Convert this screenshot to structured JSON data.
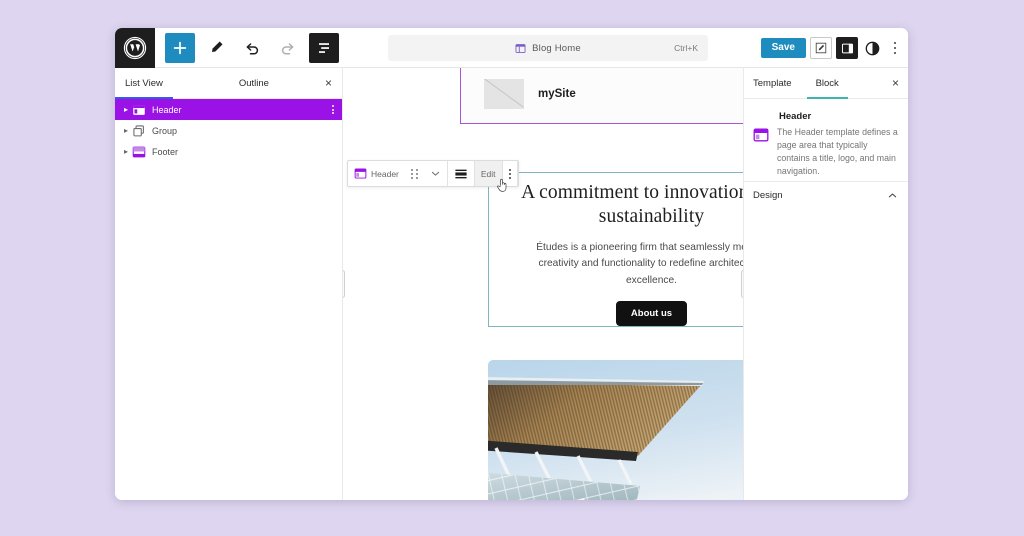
{
  "app": {
    "name": "WordPress Site Editor",
    "background_color": "#ded6f0",
    "accent_blue": "#1e8cbe",
    "selected_purple": "#9b12e6",
    "block_border_purple": "#a855d6",
    "hover_border_teal": "#7fb6c2"
  },
  "toolbar": {
    "wordpress_logo": "wordpress-logo",
    "add_block_label": "+",
    "tools": [
      {
        "name": "add-block-button",
        "icon": "plus-icon",
        "state": "active"
      },
      {
        "name": "edit-tool-button",
        "icon": "pencil-icon",
        "state": "default"
      },
      {
        "name": "undo-button",
        "icon": "undo-arrow-icon",
        "state": "enabled"
      },
      {
        "name": "redo-button",
        "icon": "redo-arrow-icon",
        "state": "disabled"
      },
      {
        "name": "list-view-button",
        "icon": "list-view-icon",
        "state": "active"
      }
    ],
    "command_palette": {
      "label": "Blog Home",
      "icon": "template-icon",
      "shortcut": "Ctrl+K"
    },
    "save_label": "Save",
    "right_buttons": [
      {
        "name": "settings-styles-button",
        "icon": "pencil-square-icon"
      },
      {
        "name": "sidebar-toggle-button",
        "icon": "panel-right-icon"
      },
      {
        "name": "styles-contrast-button",
        "icon": "contrast-circle-icon"
      },
      {
        "name": "options-menu-button",
        "icon": "dots-vertical-icon"
      }
    ]
  },
  "list_view": {
    "tabs": [
      {
        "label": "List View",
        "active": true
      },
      {
        "label": "Outline",
        "active": false
      }
    ],
    "close_label": "×",
    "items": [
      {
        "label": "Header",
        "icon": "header-template-icon",
        "selected": true,
        "expandable": true
      },
      {
        "label": "Group",
        "icon": "group-blocks-icon",
        "selected": false,
        "expandable": true
      },
      {
        "label": "Footer",
        "icon": "footer-template-icon",
        "selected": false,
        "expandable": true
      }
    ]
  },
  "block_toolbar": {
    "block_label": "Header",
    "block_icon": "header-template-icon",
    "drag_handle": "drag-handle-icon",
    "move_chevron": "chevron-down-icon",
    "align_icon": "align-full-width-icon",
    "edit_label": "Edit",
    "options_icon": "dots-vertical-icon",
    "cursor": "pointer-hand-cursor"
  },
  "canvas": {
    "site_header": {
      "logo_alt": "site-logo-placeholder",
      "site_title": "mySite",
      "nav_icon": "hamburger-menu-icon",
      "appender_label": "+"
    },
    "hero": {
      "title": "A commitment to innovation and sustainability",
      "paragraph": "Études is a pioneering firm that seamlessly merges creativity and functionality to redefine architectural excellence.",
      "cta_label": "About us"
    },
    "photo": {
      "alt": "architectural-canopy-photo",
      "description": "Wooden slatted canopy roof over a glass structure against a blue sky"
    }
  },
  "settings_sidebar": {
    "tabs": [
      {
        "label": "Template",
        "active": false
      },
      {
        "label": "Block",
        "active": true
      }
    ],
    "close_label": "×",
    "block": {
      "icon": "header-template-icon",
      "title": "Header",
      "description": "The Header template defines a page area that typically contains a title, logo, and main navigation."
    },
    "sections": [
      {
        "label": "Design",
        "expanded": true,
        "chevron": "chevron-up-icon"
      }
    ]
  }
}
